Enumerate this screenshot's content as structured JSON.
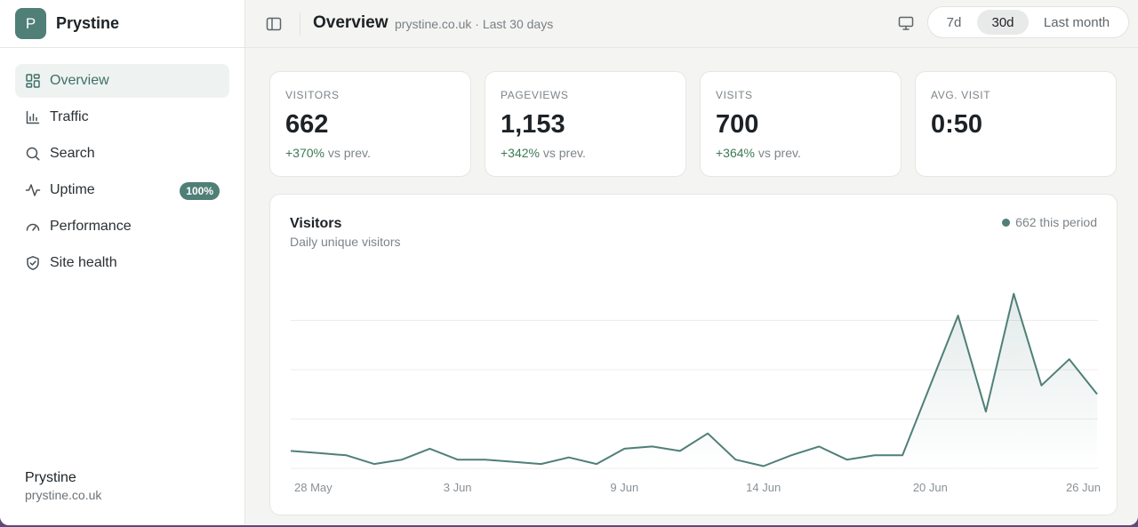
{
  "sidebar": {
    "logo_letter": "P",
    "brand": "Prystine",
    "items": [
      {
        "label": "Overview",
        "icon": "grid-icon",
        "active": true
      },
      {
        "label": "Traffic",
        "icon": "bar-chart-icon"
      },
      {
        "label": "Search",
        "icon": "search-icon"
      },
      {
        "label": "Uptime",
        "icon": "activity-icon",
        "badge": "100%"
      },
      {
        "label": "Performance",
        "icon": "gauge-icon"
      },
      {
        "label": "Site health",
        "icon": "shield-check-icon"
      }
    ],
    "footer": {
      "name": "Prystine",
      "domain": "prystine.co.uk"
    }
  },
  "header": {
    "title": "Overview",
    "subtitle": "prystine.co.uk · Last 30 days",
    "ranges": [
      "7d",
      "30d",
      "Last month"
    ],
    "selected_range": "30d"
  },
  "stats": [
    {
      "label": "VISITORS",
      "value": "662",
      "change": "+370%",
      "suffix": "vs prev."
    },
    {
      "label": "PAGEVIEWS",
      "value": "1,153",
      "change": "+342%",
      "suffix": "vs prev."
    },
    {
      "label": "VISITS",
      "value": "700",
      "change": "+364%",
      "suffix": "vs prev."
    },
    {
      "label": "AVG. VISIT",
      "value": "0:50"
    }
  ],
  "chart_data": {
    "type": "area",
    "title": "Visitors",
    "subtitle": "Daily unique visitors",
    "legend": "662 this period",
    "x": [
      "28 May",
      "29 May",
      "30 May",
      "31 May",
      "1 Jun",
      "2 Jun",
      "3 Jun",
      "4 Jun",
      "5 Jun",
      "6 Jun",
      "7 Jun",
      "8 Jun",
      "9 Jun",
      "10 Jun",
      "11 Jun",
      "12 Jun",
      "13 Jun",
      "14 Jun",
      "15 Jun",
      "16 Jun",
      "17 Jun",
      "18 Jun",
      "19 Jun",
      "20 Jun",
      "21 Jun",
      "22 Jun",
      "23 Jun",
      "24 Jun",
      "25 Jun",
      "26 Jun",
      "27 Jun"
    ],
    "tick_labels": [
      "28 May",
      "3 Jun",
      "9 Jun",
      "14 Jun",
      "20 Jun",
      "26 Jun"
    ],
    "values": [
      4,
      3.5,
      3,
      1,
      2,
      4.5,
      2,
      2,
      1.5,
      1,
      2.5,
      1,
      4.5,
      5,
      4,
      8,
      2,
      0.5,
      3,
      5,
      2,
      3,
      3,
      19,
      35,
      13,
      40,
      19,
      25,
      17
    ],
    "ylim": [
      0,
      45
    ],
    "grid": true,
    "color": "#4f7f77"
  }
}
